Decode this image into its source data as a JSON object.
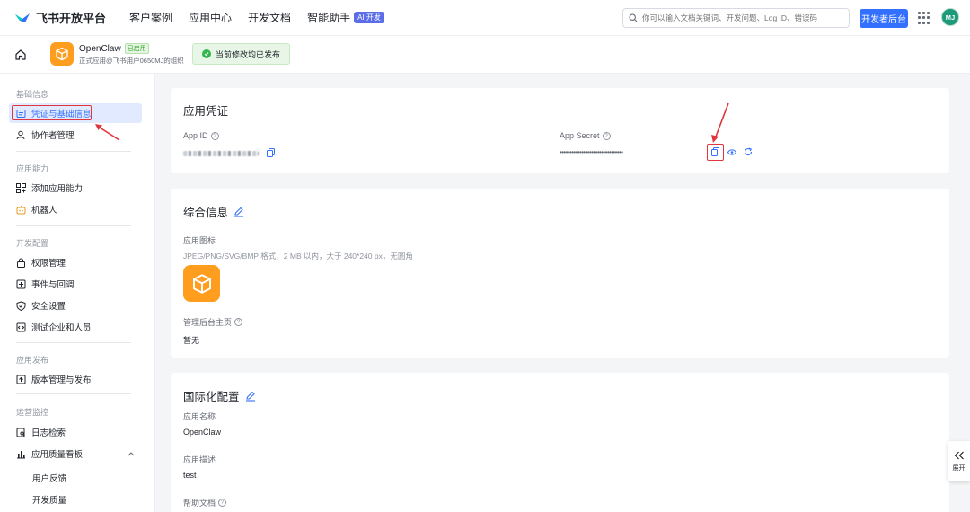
{
  "topnav": {
    "brand": "飞书开放平台",
    "links": [
      "客户案例",
      "应用中心",
      "开发文档",
      "智能助手"
    ],
    "ai_badge": "AI 开发",
    "search_placeholder": "你可以输入文档关键词、开发问题、Log ID、错误码",
    "dev_console": "开发者后台",
    "avatar": "MJ"
  },
  "appbar": {
    "app_name": "OpenClaw",
    "state_tag": "已启用",
    "app_sub": "正式应用@飞书用户0650MJ的组织",
    "publish_status": "当前修改均已发布"
  },
  "sidebar": {
    "sections": [
      {
        "label": "基础信息",
        "items": [
          "凭证与基础信息",
          "协作者管理"
        ]
      },
      {
        "label": "应用能力",
        "items": [
          "添加应用能力",
          "机器人"
        ]
      },
      {
        "label": "开发配置",
        "items": [
          "权限管理",
          "事件与回调",
          "安全设置",
          "测试企业和人员"
        ]
      },
      {
        "label": "应用发布",
        "items": [
          "版本管理与发布"
        ]
      },
      {
        "label": "运营监控",
        "items": [
          "日志检索",
          "应用质量看板"
        ]
      }
    ],
    "sub_items": [
      "用户反馈",
      "开发质量"
    ]
  },
  "credentials": {
    "title": "应用凭证",
    "app_id_label": "App ID",
    "app_secret_label": "App Secret",
    "app_secret_value": "••••••••••••••••••••••••••••••••"
  },
  "general": {
    "title": "综合信息",
    "icon_label": "应用图标",
    "icon_hint": "JPEG/PNG/SVG/BMP 格式，2 MB 以内，大于 240*240 px，无圆角",
    "homepage_label": "管理后台主页",
    "homepage_value": "暂无"
  },
  "i18n": {
    "title": "国际化配置",
    "name_label": "应用名称",
    "name_value": "OpenClaw",
    "desc_label": "应用描述",
    "desc_value": "test",
    "help_label": "帮助文档"
  },
  "expand": "展开",
  "colors": {
    "primary": "#3370ff",
    "accent_orange": "#ff9d1f",
    "highlight_red": "#e0353e",
    "success": "#34b64d"
  }
}
